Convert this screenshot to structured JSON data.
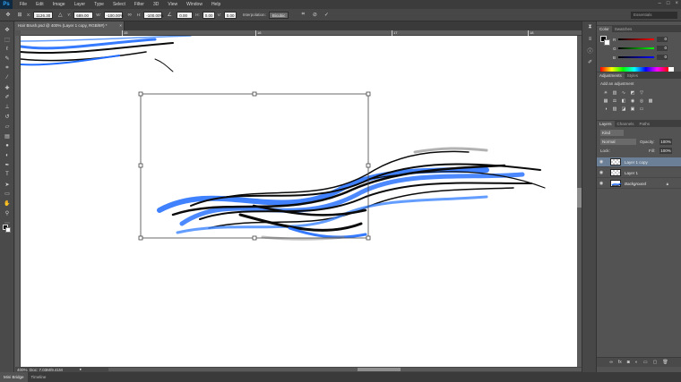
{
  "app": {
    "logo": "Ps"
  },
  "menu": [
    "File",
    "Edit",
    "Image",
    "Layer",
    "Type",
    "Select",
    "Filter",
    "3D",
    "View",
    "Window",
    "Help"
  ],
  "options": {
    "x_label": "X:",
    "x_value": "1126.30 px",
    "y_label": "Y:",
    "y_value": "689.00 px",
    "w_label": "W:",
    "w_value": "-100.00%",
    "h_label": "H:",
    "h_value": "-100.00%",
    "angle_value": "0.00",
    "hskew_label": "H:",
    "hskew_value": "0.00",
    "vskew_label": "V:",
    "vskew_value": "0.00",
    "interp_label": "Interpolation:",
    "interp_value": "Bicubic",
    "workspace": "Essentials"
  },
  "document": {
    "tab_title": "Hair Brush.psd @ 400% (Layer 1 copy, RGB/8#) *",
    "zoom": "400%",
    "doc_size": "Doc: 7.03M/9.41M"
  },
  "ruler": {
    "ticks": [
      "",
      "15",
      "16",
      "17",
      "18"
    ]
  },
  "bottom_tabs": [
    "Mini Bridge",
    "Timeline"
  ],
  "color_panel": {
    "tabs": [
      "Color",
      "Swatches"
    ],
    "r_label": "R",
    "r_value": "0",
    "g_label": "G",
    "g_value": "0",
    "b_label": "B",
    "b_value": "0"
  },
  "adjustments_panel": {
    "tabs": [
      "Adjustments",
      "Styles"
    ],
    "title": "Add an adjustment"
  },
  "layers_panel": {
    "tabs": [
      "Layers",
      "Channels",
      "Paths"
    ],
    "kind": "Kind",
    "blend_mode": "Normal",
    "opacity_label": "Opacity:",
    "opacity_value": "100%",
    "lock_label": "Lock:",
    "fill_label": "Fill:",
    "fill_value": "100%",
    "layers": [
      {
        "name": "Layer 1 copy",
        "selected": true
      },
      {
        "name": "Layer 1",
        "selected": false
      },
      {
        "name": "Background",
        "selected": false
      }
    ]
  },
  "colors": {
    "accent_selected": "#6b7f97",
    "brush_dark": "#0a0a0a",
    "brush_blue": "#1f6bff"
  }
}
